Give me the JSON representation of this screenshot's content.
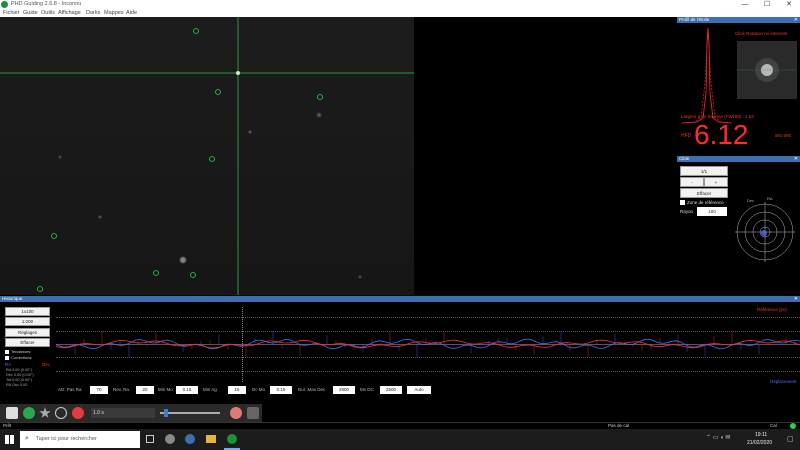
{
  "window": {
    "title": "PHD Guiding 2.6.8 - Inconnu",
    "minimize": "—",
    "maximize": "☐",
    "close": "✕"
  },
  "menu": [
    "Fichier",
    "Guide",
    "Outils",
    "Affichage",
    "Darks",
    "Mappes",
    "Aide"
  ],
  "star_profile": {
    "panel_title": "Profil de l'étoile",
    "hint": "Click-Rotation mi-intensité",
    "fwhm_label": "Largeur à mi-hauteur (FWHM) : 1.52",
    "hfd_label": "HFD",
    "hfd_value": "6.12",
    "hfd_unit": "arc-sec",
    "colors": {
      "curve": "#ff2a2a",
      "text": "#ff2a2a"
    }
  },
  "target": {
    "panel_title": "Cible",
    "zoom_value": "1/1",
    "minus": "-",
    "plus": "+",
    "clear_label": "Effacer",
    "show_zone_label": "Zone de référence",
    "scale_label": "Rayon",
    "scale_value": "100",
    "ra_label": "RA",
    "dec_label": "Dec"
  },
  "graph": {
    "panel_title": "Historique",
    "zoom_x": "1x100",
    "zoom_y": "1:200",
    "settings_label": "Réglages",
    "clear_label": "Effacer",
    "trendlines_label": "Tendances",
    "corrections_label": "Corrections",
    "left_ra": "RA",
    "left_dec": "Dec",
    "rms_lines": [
      "RA 0.00 (0.00'')",
      "Dec 0.00 (0.00'')",
      "Tot 0.00 (0.00'')",
      "RA Osc 0.00"
    ],
    "right_top_label": "Référence (px)",
    "right_bottom_label": "Déplacement",
    "params": [
      {
        "label": "AD: Pas Ra",
        "value": "70"
      },
      {
        "label": "Rev. Ra",
        "value": "20"
      },
      {
        "label": "Min Mo",
        "value": "0.15"
      },
      {
        "label": "Min Ag",
        "value": "15"
      },
      {
        "label": "Dc Mo",
        "value": "0.15"
      },
      {
        "label": "Dur. Max Dec",
        "value": "2500"
      },
      {
        "label": "Mx DC",
        "value": "2500"
      },
      {
        "label": "Auto",
        "value": "Auto"
      }
    ],
    "colors": {
      "ra": "#4a6cff",
      "dec": "#ff3030"
    }
  },
  "toolbar": {
    "exposure_value": "1.0 s"
  },
  "status": {
    "left": "Prêt",
    "right_info": "Pas de cal",
    "cal_label": "Cal"
  },
  "taskbar": {
    "search_placeholder": "Taper ici pour rechercher",
    "time": "19:11",
    "date": "21/02/2020"
  }
}
